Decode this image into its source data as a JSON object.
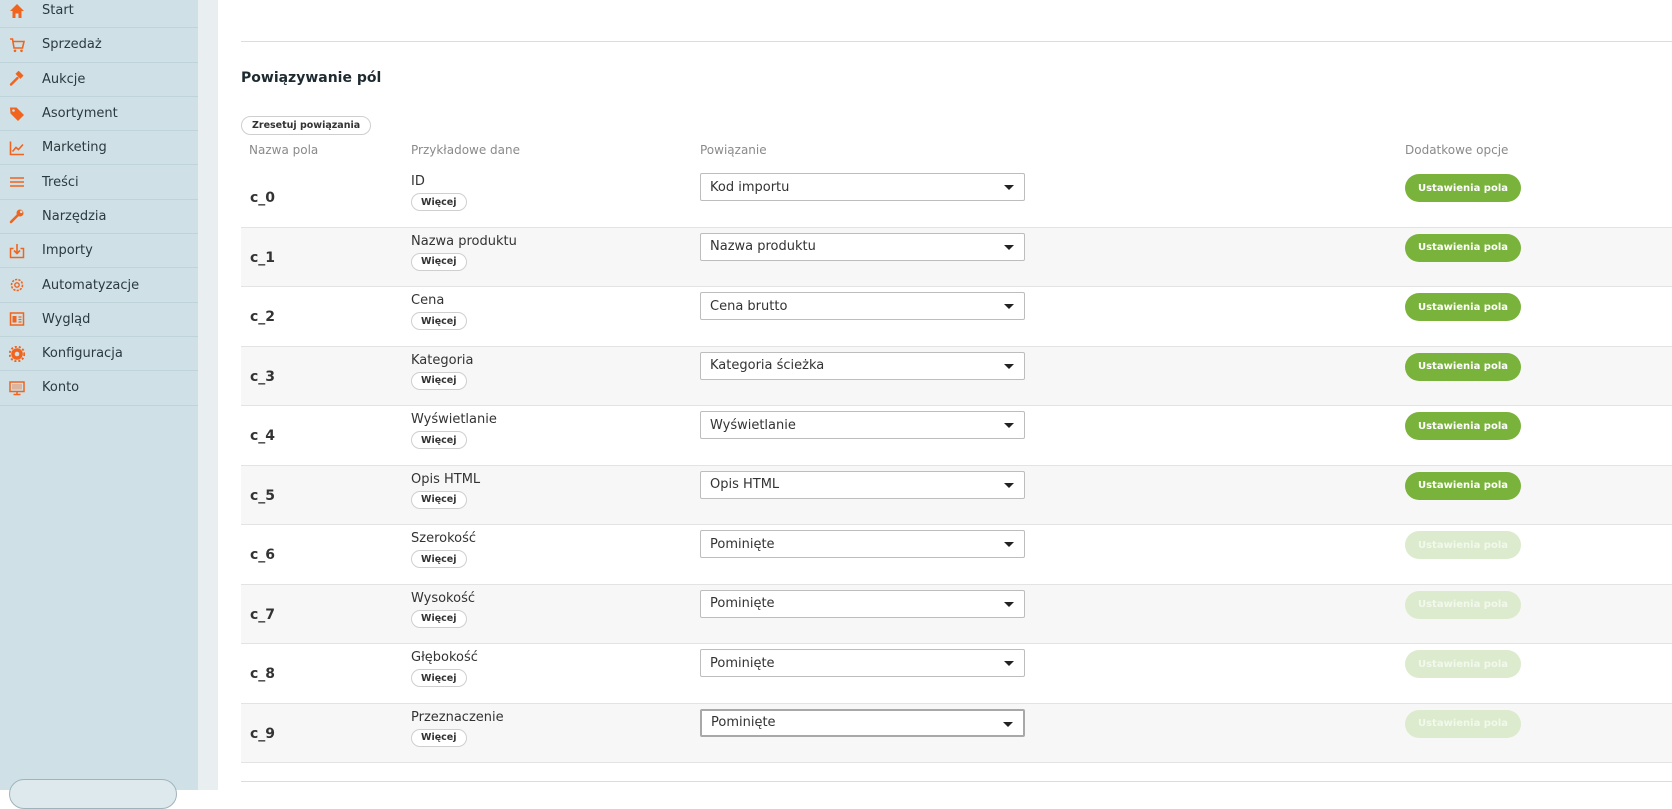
{
  "sidebar": {
    "items": [
      {
        "label": "Start",
        "icon": "home-icon"
      },
      {
        "label": "Sprzedaż",
        "icon": "cart-icon"
      },
      {
        "label": "Aukcje",
        "icon": "hammer-icon"
      },
      {
        "label": "Asortyment",
        "icon": "tag-icon"
      },
      {
        "label": "Marketing",
        "icon": "chart-icon"
      },
      {
        "label": "Treści",
        "icon": "lines-icon"
      },
      {
        "label": "Narzędzia",
        "icon": "wrench-icon"
      },
      {
        "label": "Importy",
        "icon": "import-icon"
      },
      {
        "label": "Automatyzacje",
        "icon": "gear-outline-icon"
      },
      {
        "label": "Wygląd",
        "icon": "layout-icon"
      },
      {
        "label": "Konfiguracja",
        "icon": "gear-icon"
      },
      {
        "label": "Konto",
        "icon": "monitor-icon"
      }
    ],
    "icon_color": "#f0641e"
  },
  "main": {
    "section_title": "Powiązywanie pól",
    "reset_label": "Zresetuj powiązania",
    "columns": {
      "field_name": "Nazwa pola",
      "sample_data": "Przykładowe dane",
      "binding": "Powiązanie",
      "extra_options": "Dodatkowe opcje"
    },
    "more_label": "Więcej",
    "options_label": "Ustawienia pola",
    "rows": [
      {
        "name": "c_0",
        "sample": "ID",
        "binding": "Kod importu",
        "options_enabled": true
      },
      {
        "name": "c_1",
        "sample": "Nazwa produktu",
        "binding": "Nazwa produktu",
        "options_enabled": true
      },
      {
        "name": "c_2",
        "sample": "Cena",
        "binding": "Cena brutto",
        "options_enabled": true
      },
      {
        "name": "c_3",
        "sample": "Kategoria",
        "binding": "Kategoria ścieżka",
        "options_enabled": true
      },
      {
        "name": "c_4",
        "sample": "Wyświetlanie",
        "binding": "Wyświetlanie",
        "options_enabled": true
      },
      {
        "name": "c_5",
        "sample": "Opis HTML",
        "binding": "Opis HTML",
        "options_enabled": true
      },
      {
        "name": "c_6",
        "sample": "Szerokość",
        "binding": "Pominięte",
        "options_enabled": false
      },
      {
        "name": "c_7",
        "sample": "Wysokość",
        "binding": "Pominięte",
        "options_enabled": false
      },
      {
        "name": "c_8",
        "sample": "Głębokość",
        "binding": "Pominięte",
        "options_enabled": false
      },
      {
        "name": "c_9",
        "sample": "Przeznaczenie",
        "binding": "Pominięte",
        "options_enabled": false
      }
    ],
    "accent_color": "#7ab33b"
  }
}
